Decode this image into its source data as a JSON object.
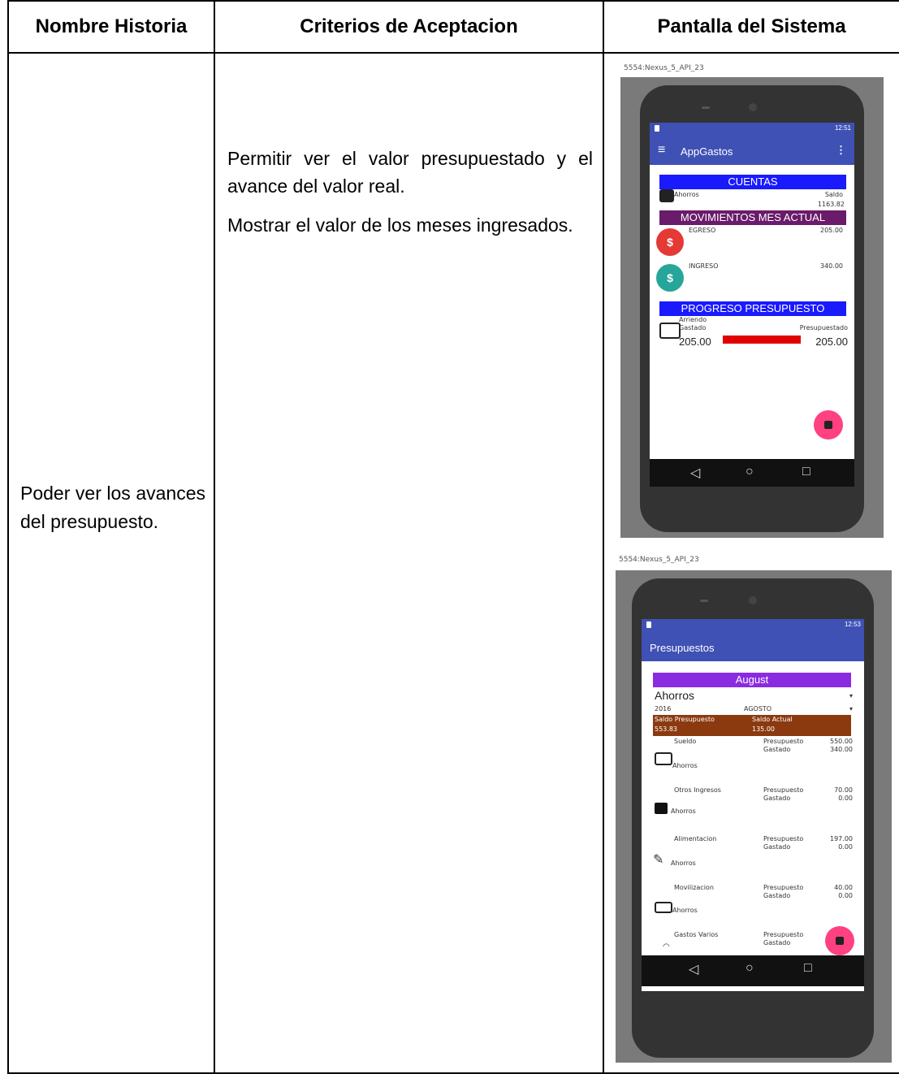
{
  "headers": {
    "col1": "Nombre Historia",
    "col2": "Criterios de Aceptacion",
    "col3": "Pantalla del Sistema"
  },
  "story": {
    "text": "Poder ver los avances del presupuesto."
  },
  "criteria": [
    "Permitir ver el valor presupuestado y el avance del valor real.",
    "Mostrar el valor de los meses ingresados."
  ],
  "screen1": {
    "window_title": "5554:Nexus_5_API_23",
    "status_time": "12:51",
    "app_title": "AppGastos",
    "cuentas_band": "CUENTAS",
    "account_name": "Ahorros",
    "saldo_label": "Saldo",
    "saldo_value": "1163.82",
    "movimientos_band": "MOVIMIENTOS MES ACTUAL",
    "egreso_label": "EGRESO",
    "egreso_value": "205.00",
    "ingreso_label": "INGRESO",
    "ingreso_value": "340.00",
    "progreso_band": "PROGRESO PRESUPUESTO",
    "arriendo_label": "Arriendo",
    "gastado_label": "Gastado",
    "presupuestado_label": "Presupuestado",
    "gastado_value": "205.00",
    "presupuestado_value": "205.00",
    "progress_fraction": 1.0,
    "colors": {
      "primary": "#3f51b5",
      "cuentas": "#1a1aff",
      "movimientos": "#6a1b6a",
      "progreso": "#1a1aff",
      "egreso_circle": "#e53935",
      "ingreso_circle": "#26a69a",
      "fab": "#ff4081",
      "progress_bar": "#e00000"
    }
  },
  "screen2": {
    "window_title": "5554:Nexus_5_API_23",
    "status_time": "12:53",
    "app_title": "Presupuestos",
    "month_band": "August",
    "account_select": "Ahorros",
    "year_select": "2016",
    "month_select": "AGOSTO",
    "saldo_presupuesto_label": "Saldo Presupuesto",
    "saldo_presupuesto_value": "553.83",
    "saldo_actual_label": "Saldo Actual",
    "saldo_actual_value": "135.00",
    "presupuesto_label": "Presupuesto",
    "gastado_label": "Gastado",
    "items": [
      {
        "name": "Sueldo",
        "account": "Ahorros",
        "presupuesto": "550.00",
        "gastado": "340.00",
        "icon": "cash-icon"
      },
      {
        "name": "Otros Ingresos",
        "account": "Ahorros",
        "presupuesto": "70.00",
        "gastado": "0.00",
        "icon": "moneybag-icon"
      },
      {
        "name": "Alimentacion",
        "account": "Ahorros",
        "presupuesto": "197.00",
        "gastado": "0.00",
        "icon": "food-icon"
      },
      {
        "name": "Movilizacion",
        "account": "Ahorros",
        "presupuesto": "40.00",
        "gastado": "0.00",
        "icon": "bus-icon"
      },
      {
        "name": "Gastos Varios",
        "account": "",
        "presupuesto": "",
        "gastado": "",
        "icon": "gauge-icon"
      }
    ],
    "colors": {
      "month_band": "#8a2be2",
      "saldo_band": "#8b3a0f"
    }
  }
}
